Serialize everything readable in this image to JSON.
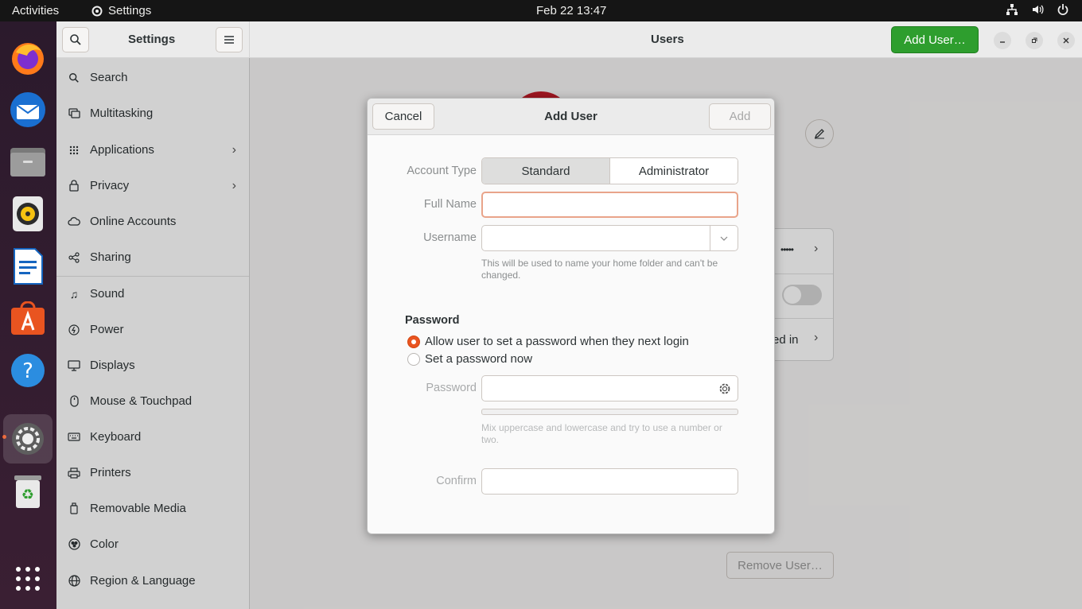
{
  "topbar": {
    "activities": "Activities",
    "app_name": "Settings",
    "clock": "Feb 22  13:47"
  },
  "dock": {
    "items": [
      "firefox-icon",
      "thunderbird-icon",
      "files-icon",
      "rhythmbox-icon",
      "libreoffice-writer-icon",
      "software-icon",
      "help-icon",
      "settings-icon",
      "trash-icon",
      "show-apps-icon"
    ]
  },
  "window": {
    "sidebar_title": "Settings",
    "page_title": "Users",
    "add_user_label": "Add User…",
    "remove_user_label": "Remove User…",
    "password_mask": "•••••",
    "logged_in_fragment": "ed in"
  },
  "sidebar": {
    "items": [
      {
        "label": "Search"
      },
      {
        "label": "Multitasking"
      },
      {
        "label": "Applications"
      },
      {
        "label": "Privacy"
      },
      {
        "label": "Online Accounts"
      },
      {
        "label": "Sharing"
      },
      {
        "label": "Sound"
      },
      {
        "label": "Power"
      },
      {
        "label": "Displays"
      },
      {
        "label": "Mouse & Touchpad"
      },
      {
        "label": "Keyboard"
      },
      {
        "label": "Printers"
      },
      {
        "label": "Removable Media"
      },
      {
        "label": "Color"
      },
      {
        "label": "Region & Language"
      }
    ]
  },
  "dialog": {
    "title": "Add User",
    "cancel_label": "Cancel",
    "add_label": "Add",
    "account_type_label": "Account Type",
    "account_type_options": [
      "Standard",
      "Administrator"
    ],
    "account_type_selected": "Standard",
    "full_name_label": "Full Name",
    "full_name_value": "",
    "username_label": "Username",
    "username_value": "",
    "username_hint": "This will be used to name your home folder and can't be changed.",
    "password_section": "Password",
    "radio_allow": "Allow user to set a password when they next login",
    "radio_set": "Set a password now",
    "password_label": "Password",
    "password_hint": "Mix uppercase and lowercase and try to use a number or two.",
    "confirm_label": "Confirm"
  },
  "colors": {
    "accent": "#e95420",
    "add_user_green": "#2e9e2e"
  }
}
